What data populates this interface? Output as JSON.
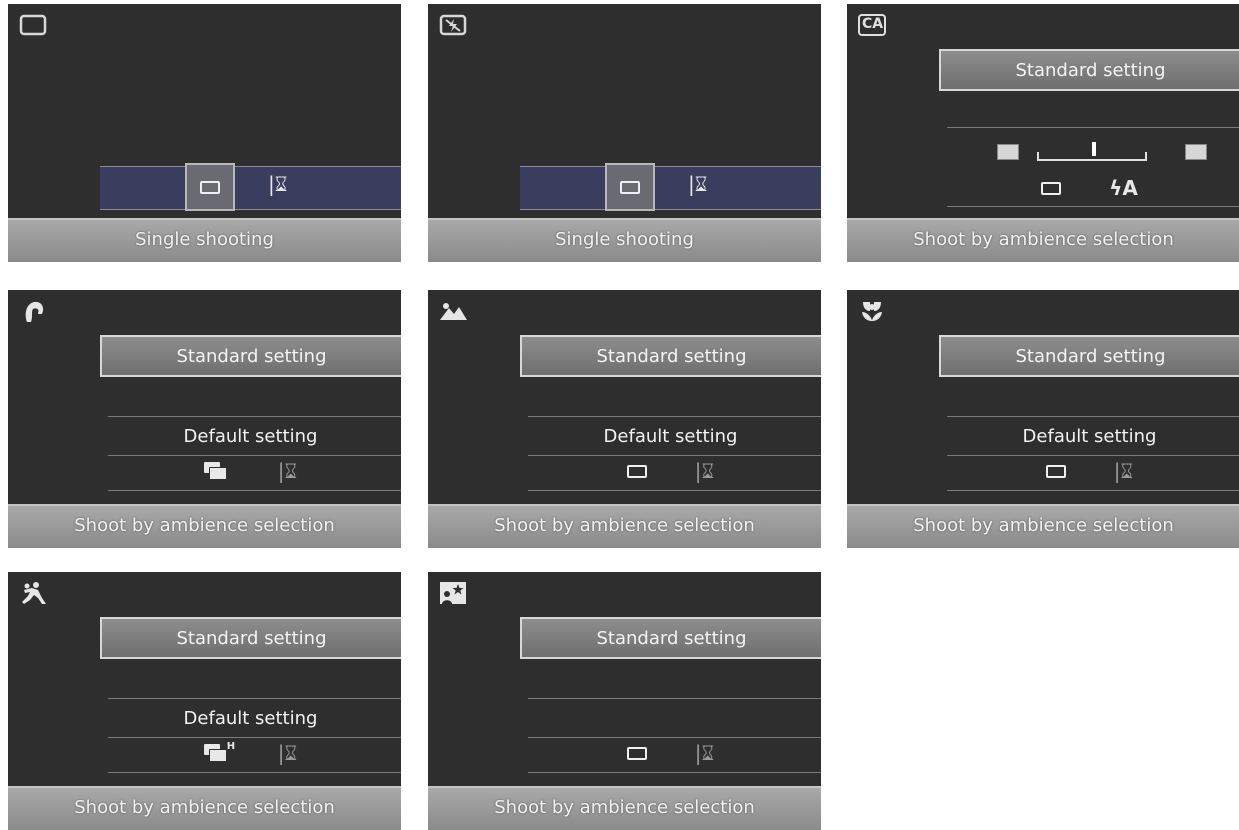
{
  "labels": {
    "single_shooting": "Single shooting",
    "shoot_by_ambience": "Shoot by ambience selection",
    "standard_setting": "Standard setting",
    "default_setting": "Default setting",
    "ca": "CA",
    "continuous_h": "H",
    "flash_auto": "ϟA"
  },
  "screens": [
    {
      "mode": "Full Auto",
      "icon": "rectangle-outline-icon"
    },
    {
      "mode": "Flash Off",
      "icon": "flash-off-icon"
    },
    {
      "mode": "Creative Auto",
      "icon": "ca-icon"
    },
    {
      "mode": "Portrait",
      "icon": "portrait-icon"
    },
    {
      "mode": "Landscape",
      "icon": "landscape-icon"
    },
    {
      "mode": "Close-up",
      "icon": "flower-icon"
    },
    {
      "mode": "Sports",
      "icon": "runner-icon"
    },
    {
      "mode": "Night Portrait",
      "icon": "night-portrait-icon"
    }
  ],
  "colors": {
    "screen_bg": "#2e2e2e",
    "footer_bg": "#9a9a9a",
    "button_bg": "#7e7e7e",
    "drive_strip_bg": "#3b3d5e"
  }
}
